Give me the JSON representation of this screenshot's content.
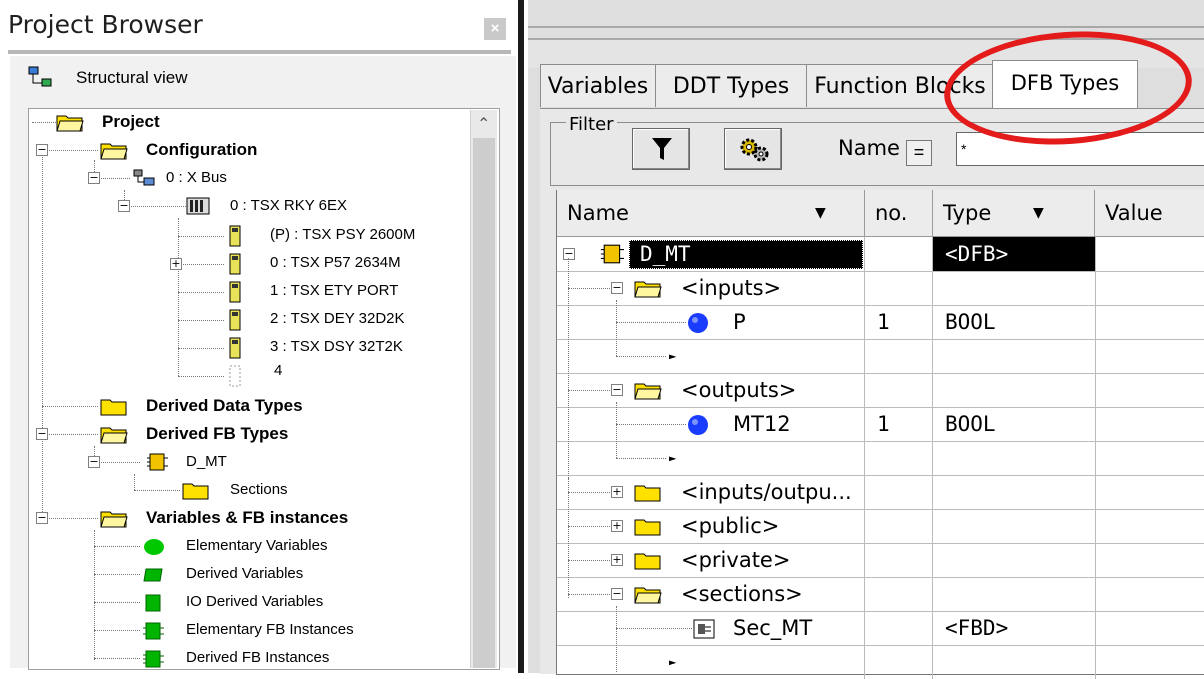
{
  "project_browser": {
    "title": "Project Browser",
    "close_glyph": "×",
    "view_label": "Structural view",
    "tree": {
      "project": "Project",
      "configuration": "Configuration",
      "bus": "0 : X Bus",
      "rack": "0 : TSX RKY 6EX",
      "modules": [
        "(P) : TSX PSY 2600M",
        "0 : TSX P57 2634M",
        "1 : TSX ETY PORT",
        "2 : TSX DEY 32D2K",
        "3 : TSX DSY 32T2K",
        "4"
      ],
      "derived_data_types": "Derived Data Types",
      "derived_fb_types": "Derived FB Types",
      "dfb": "D_MT",
      "sections": "Sections",
      "variables_fb": "Variables & FB instances",
      "var_items": [
        "Elementary Variables",
        "Derived Variables",
        "IO Derived Variables",
        "Elementary FB Instances",
        "Derived FB Instances"
      ]
    }
  },
  "editor": {
    "tabs": [
      "Variables",
      "DDT Types",
      "Function Blocks",
      "DFB Types"
    ],
    "active_tab": "DFB Types",
    "filter": {
      "label": "Filter",
      "name_label": "Name",
      "eq_label": "=",
      "name_value": "*"
    },
    "columns": [
      "Name",
      "no.",
      "Type",
      "Value"
    ],
    "rows": [
      {
        "name": "D_MT",
        "no": "",
        "type": "<DFB>"
      },
      {
        "name": "<inputs>",
        "no": "",
        "type": ""
      },
      {
        "name": "P",
        "no": "1",
        "type": "BOOL"
      },
      {
        "name": "",
        "no": "",
        "type": ""
      },
      {
        "name": "<outputs>",
        "no": "",
        "type": ""
      },
      {
        "name": "MT12",
        "no": "1",
        "type": "BOOL"
      },
      {
        "name": "",
        "no": "",
        "type": ""
      },
      {
        "name": "<inputs/outpu...",
        "no": "",
        "type": ""
      },
      {
        "name": "<public>",
        "no": "",
        "type": ""
      },
      {
        "name": "<private>",
        "no": "",
        "type": ""
      },
      {
        "name": "<sections>",
        "no": "",
        "type": ""
      },
      {
        "name": "Sec_MT",
        "no": "",
        "type": "<FBD>"
      }
    ]
  },
  "colors": {
    "highlight_ellipse": "#e31b1b",
    "folder": "#ffe100",
    "bullet": "#1a3cff",
    "green": "#00c800"
  },
  "icons": [
    "folder-icon",
    "bus-icon",
    "rack-icon",
    "module-icon",
    "dfb-icon",
    "filter-icon",
    "gear-icon",
    "fbd-section-icon",
    "variable-bullet-icon",
    "caret-icon"
  ]
}
